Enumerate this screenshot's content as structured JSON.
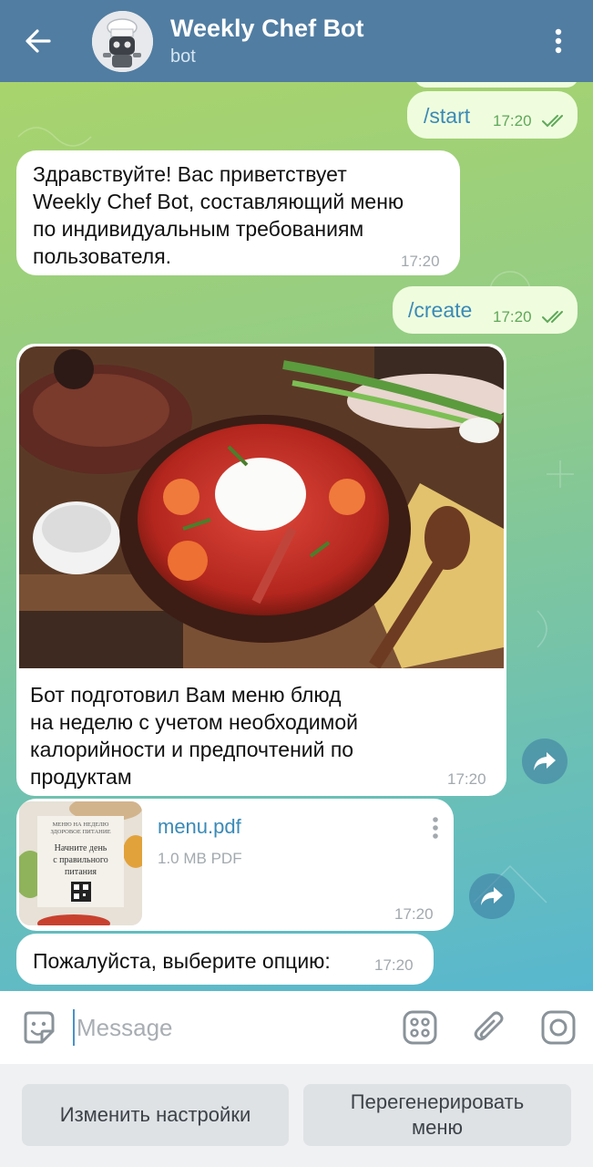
{
  "header": {
    "title": "Weekly Chef Bot",
    "subtitle": "bot"
  },
  "messages": {
    "start": {
      "text": "/start",
      "time": "17:20"
    },
    "welcome": {
      "lines": [
        "Здравствуйте! Вас приветствует",
        "Weekly Chef Bot, составляющий меню",
        "по индивидуальным требованиям",
        "пользователя."
      ],
      "time": "17:20"
    },
    "create": {
      "text": "/create",
      "time": "17:20"
    },
    "menu_photo": {
      "caption_lines": [
        "Бот подготовил Вам меню блюд",
        "на неделю с учетом необходимой",
        "калорийности и предпочтений по",
        "продуктам"
      ],
      "time": "17:20"
    },
    "document": {
      "file_name": "menu.pdf",
      "file_info": "1.0 MB PDF",
      "time": "17:20",
      "thumb_lines": [
        "МЕНЮ НА НЕДЕЛЮ",
        "ЗДОРОВОЕ ПИТАНИЕ",
        "Начните день",
        "с правильного",
        "питания"
      ]
    },
    "choose": {
      "text": "Пожалуйста, выберите опцию:",
      "time": "17:20"
    }
  },
  "input": {
    "placeholder": "Message"
  },
  "keyboard": {
    "buttons": [
      "Изменить настройки",
      "Перегенерировать меню"
    ]
  },
  "colors": {
    "header_bg": "#517da2",
    "incoming_bubble": "#ffffff",
    "outgoing_bubble": "#effdde",
    "link": "#3a8ab7",
    "read_checks": "#5fa85a"
  },
  "icons": [
    "back-arrow-icon",
    "more-vertical-icon",
    "double-check-icon",
    "share-icon",
    "emoji-icon",
    "bot-commands-icon",
    "attach-icon",
    "camera-icon"
  ]
}
